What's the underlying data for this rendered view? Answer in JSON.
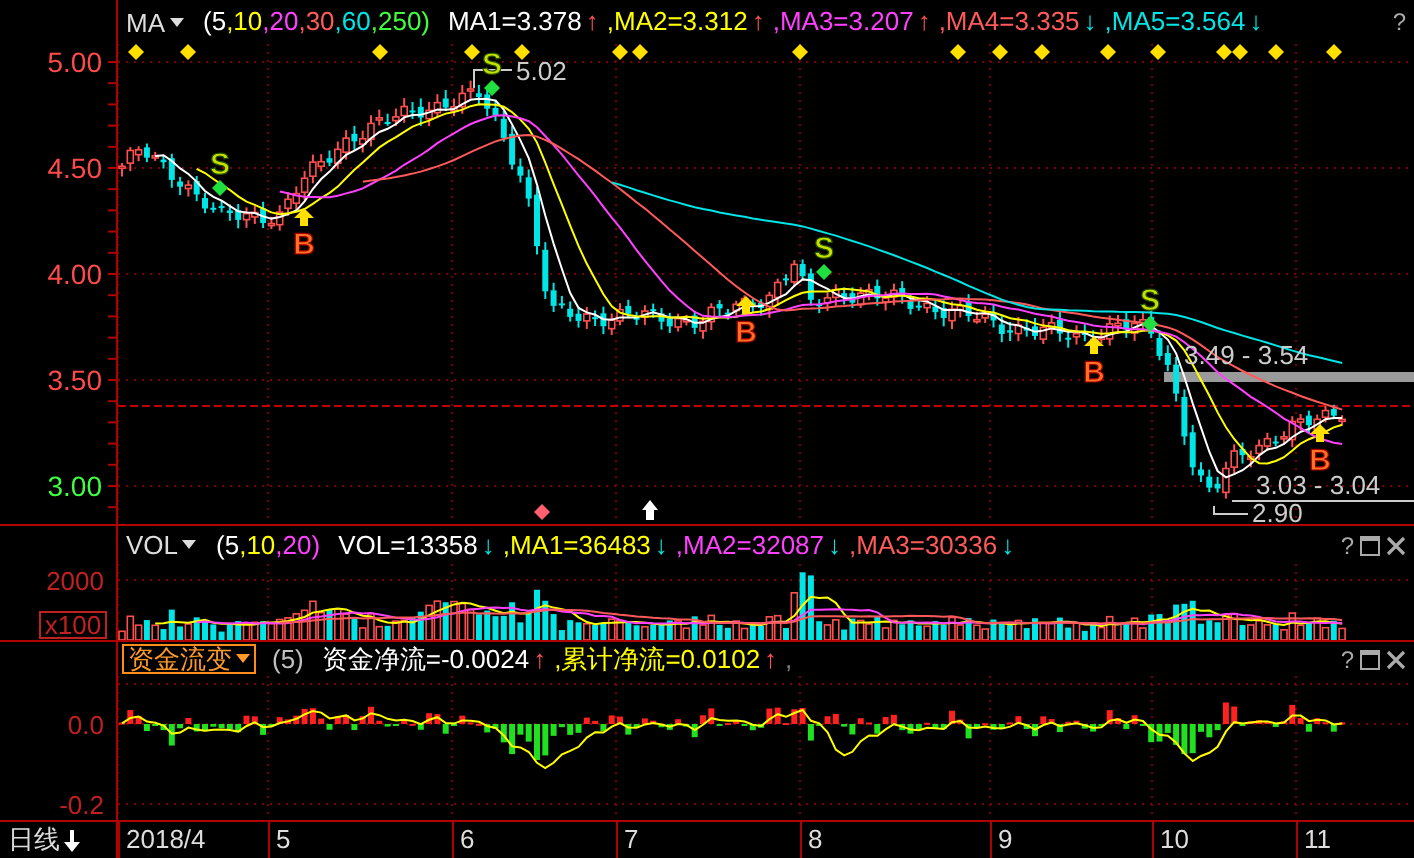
{
  "price_pane": {
    "indicator": {
      "label": "MA",
      "params": [
        {
          "text": "(5",
          "color": "#ffffff"
        },
        {
          "text": ",10",
          "color": "#ffff00"
        },
        {
          "text": ",20",
          "color": "#ff40ff"
        },
        {
          "text": ",30",
          "color": "#ff5a5a"
        },
        {
          "text": ",60",
          "color": "#00e5e5"
        },
        {
          "text": ",250)",
          "color": "#40ff40"
        }
      ]
    },
    "values": [
      {
        "text": "MA1=3.378",
        "color": "#ffffff",
        "arrow": {
          "text": "↑",
          "color": "#ff5050"
        }
      },
      {
        "text": ",MA2=3.312",
        "color": "#ffff00",
        "arrow": {
          "text": "↑",
          "color": "#ff5050"
        }
      },
      {
        "text": ",MA3=3.207",
        "color": "#ff40ff",
        "arrow": {
          "text": "↑",
          "color": "#ff5050"
        }
      },
      {
        "text": ",MA4=3.335",
        "color": "#ff5a5a",
        "arrow": {
          "text": "↓",
          "color": "#00e5e5"
        }
      },
      {
        "text": ",MA5=3.564",
        "color": "#00e5e5",
        "arrow": {
          "text": "↓",
          "color": "#00e5e5"
        }
      }
    ],
    "help": "?",
    "axis_labels": [
      {
        "text": "5.00",
        "color": "#ff4a4a"
      },
      {
        "text": "4.50",
        "color": "#ff4a4a"
      },
      {
        "text": "4.00",
        "color": "#ff4a4a"
      },
      {
        "text": "3.50",
        "color": "#ff4a4a"
      },
      {
        "text": "3.00",
        "color": "#40ff40"
      }
    ],
    "signals": [
      {
        "label": "S",
        "kind": "sell"
      },
      {
        "label": "B",
        "kind": "buy"
      },
      {
        "label": "S",
        "kind": "sell"
      },
      {
        "label": "B",
        "kind": "buy"
      },
      {
        "label": "S",
        "kind": "sell"
      },
      {
        "label": "B",
        "kind": "buy"
      },
      {
        "label": "S",
        "kind": "sell"
      },
      {
        "label": "B",
        "kind": "buy"
      }
    ],
    "annotations": [
      "5.02",
      "3.49 - 3.54",
      "3.03 - 3.04",
      "2.90"
    ]
  },
  "volume_pane": {
    "indicator": {
      "label": "VOL",
      "params": [
        {
          "text": "(5",
          "color": "#ffffff"
        },
        {
          "text": ",10",
          "color": "#ffff00"
        },
        {
          "text": ",20)",
          "color": "#ff40ff"
        }
      ]
    },
    "values": [
      {
        "text": "VOL=13358",
        "color": "#ffffff",
        "arrow": {
          "text": "↓",
          "color": "#00e5e5"
        }
      },
      {
        "text": ",MA1=36483",
        "color": "#ffff00",
        "arrow": {
          "text": "↓",
          "color": "#00e5e5"
        }
      },
      {
        "text": ",MA2=32087",
        "color": "#ff40ff",
        "arrow": {
          "text": "↓",
          "color": "#00e5e5"
        }
      },
      {
        "text": ",MA3=30336",
        "color": "#ff5a5a",
        "arrow": {
          "text": "↓",
          "color": "#00e5e5"
        }
      }
    ],
    "help": "?",
    "axis_labels": [
      "2000"
    ],
    "unit": "x100"
  },
  "flow_pane": {
    "indicator": {
      "label": "资金流变",
      "params": [
        {
          "text": "(5)",
          "color": "#c0c0c0"
        }
      ]
    },
    "values": [
      {
        "text": "资金净流=-0.0024",
        "color": "#ffffff",
        "arrow": {
          "text": "↑",
          "color": "#ff5050"
        }
      },
      {
        "text": ",累计净流=0.0102",
        "color": "#ffff00",
        "arrow": {
          "text": "↑",
          "color": "#ff5050"
        }
      },
      {
        "text": ",",
        "color": "#808080"
      }
    ],
    "help": "?",
    "axis_labels": [
      "0.0",
      "-0.2"
    ]
  },
  "time_axis": {
    "period": "日线",
    "months": [
      "2018/4",
      "5",
      "6",
      "7",
      "8",
      "9",
      "10",
      "11"
    ]
  }
}
